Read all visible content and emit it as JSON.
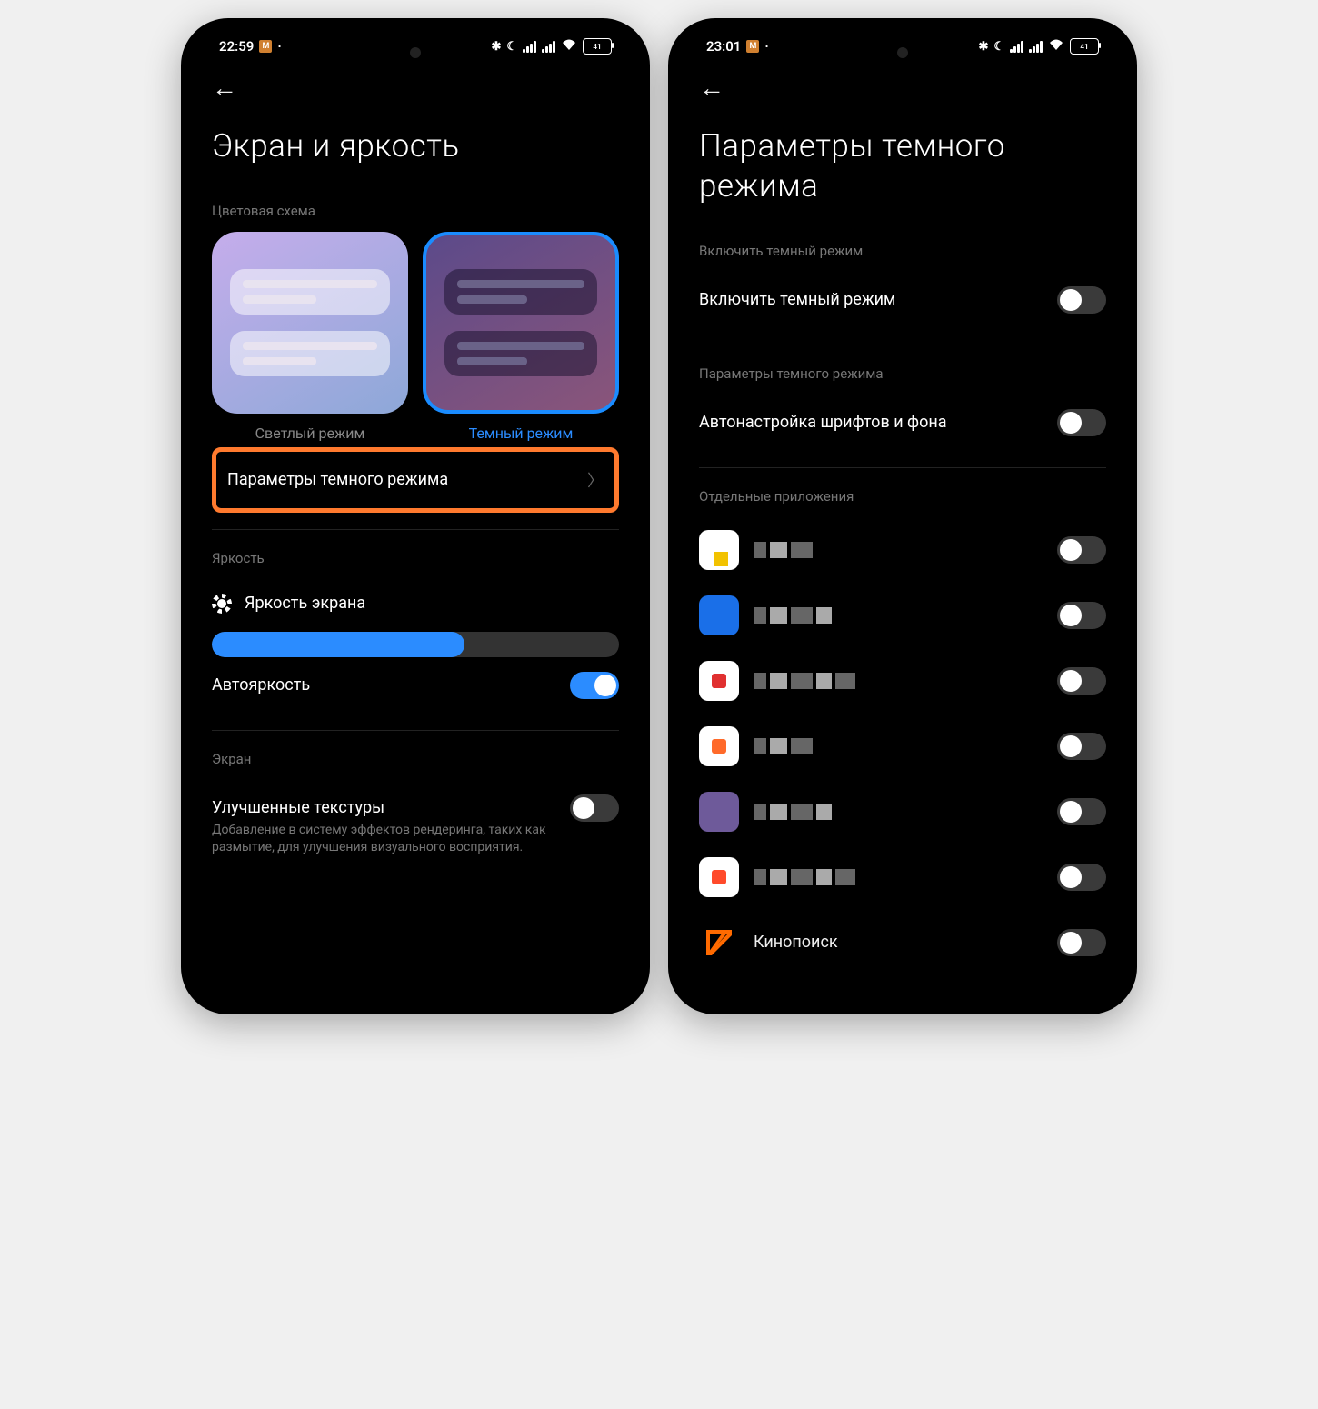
{
  "left": {
    "statusbar": {
      "time": "22:59",
      "battery": "41"
    },
    "title": "Экран и яркость",
    "colorScheme": {
      "label": "Цветовая схема",
      "light": "Светлый режим",
      "dark": "Темный режим"
    },
    "darkSettings": "Параметры темного режима",
    "brightness": {
      "label": "Яркость",
      "screen": "Яркость экрана",
      "percent": 62,
      "auto": "Автояркость"
    },
    "screenSection": {
      "label": "Экран",
      "enhanced": "Улучшенные текстуры",
      "enhancedSub": "Добавление в систему эффектов рендеринга, таких как размытие, для улучшения визуального восприятия."
    }
  },
  "right": {
    "statusbar": {
      "time": "23:01",
      "battery": "41"
    },
    "title": "Параметры темного режима",
    "enableSection": {
      "label": "Включить темный режим",
      "toggleLabel": "Включить темный режим"
    },
    "paramsSection": {
      "label": "Параметры темного режима",
      "autoAdjust": "Автонастройка шрифтов и фона"
    },
    "appsSection": {
      "label": "Отдельные приложения",
      "apps": [
        {
          "name": "",
          "color": "#fff",
          "accent": "#f2c200"
        },
        {
          "name": "",
          "color": "#1a6fe8",
          "accent": "#1a6fe8"
        },
        {
          "name": "",
          "color": "#fff",
          "accent": "#e03030"
        },
        {
          "name": "",
          "color": "#fff",
          "accent": "#ff6a2a"
        },
        {
          "name": "",
          "color": "#6e5a9a",
          "accent": "#6e5a9a"
        },
        {
          "name": "",
          "color": "#fff",
          "accent": "#ff4a2a"
        },
        {
          "name": "Кинопоиск",
          "color": "#000",
          "accent": "#ff6a00"
        }
      ]
    }
  }
}
